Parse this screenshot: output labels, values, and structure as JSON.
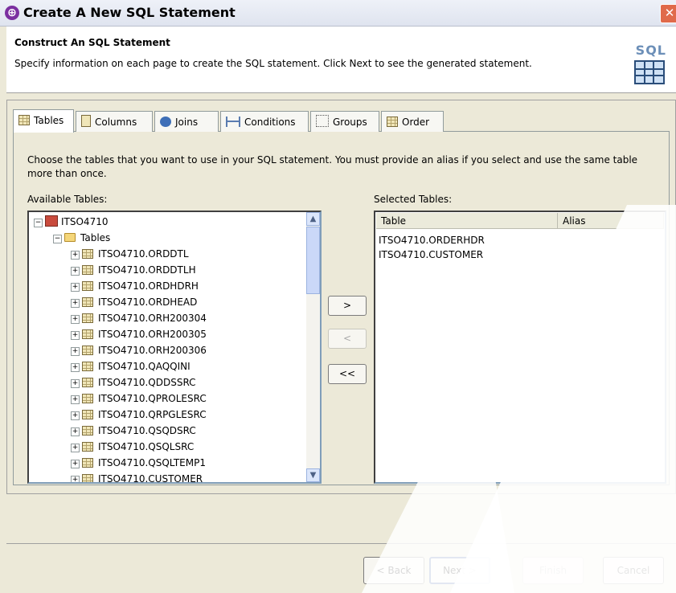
{
  "window": {
    "title": "Create A New SQL Statement"
  },
  "header": {
    "title": "Construct An SQL Statement",
    "description": "Specify information on each page to create the SQL statement. Click Next to see the generated statement.",
    "logo_text": "SQL"
  },
  "tabs": [
    {
      "label": "Tables",
      "icon": "table-icon",
      "active": true
    },
    {
      "label": "Columns",
      "icon": "columns-icon",
      "active": false
    },
    {
      "label": "Joins",
      "icon": "joins-icon",
      "active": false
    },
    {
      "label": "Conditions",
      "icon": "conditions-icon",
      "active": false
    },
    {
      "label": "Groups",
      "icon": "groups-icon",
      "active": false
    },
    {
      "label": "Order",
      "icon": "order-icon",
      "active": false
    }
  ],
  "instructions": "Choose the tables that you want to use in your SQL statement. You must provide an alias if you select and use the same table more than once.",
  "available": {
    "label": "Available Tables:",
    "root": "ITSO4710",
    "folder": "Tables",
    "items": [
      "ITSO4710.ORDDTL",
      "ITSO4710.ORDDTLH",
      "ITSO4710.ORDHDRH",
      "ITSO4710.ORDHEAD",
      "ITSO4710.ORH200304",
      "ITSO4710.ORH200305",
      "ITSO4710.ORH200306",
      "ITSO4710.QAQQINI",
      "ITSO4710.QDDSSRC",
      "ITSO4710.QPROLESRC",
      "ITSO4710.QRPGLESRC",
      "ITSO4710.QSQDSRC",
      "ITSO4710.QSQLSRC",
      "ITSO4710.QSQLTEMP1",
      "ITSO4710.CUSTOMER"
    ]
  },
  "move_buttons": {
    "add": ">",
    "remove": "<",
    "remove_all": "<<"
  },
  "selected": {
    "label": "Selected Tables:",
    "columns": [
      "Table",
      "Alias"
    ],
    "rows": [
      "ITSO4710.ORDERHDR",
      "ITSO4710.CUSTOMER"
    ]
  },
  "footer": {
    "back": "< Back",
    "next": "Next >",
    "finish": "Finish",
    "cancel": "Cancel"
  }
}
